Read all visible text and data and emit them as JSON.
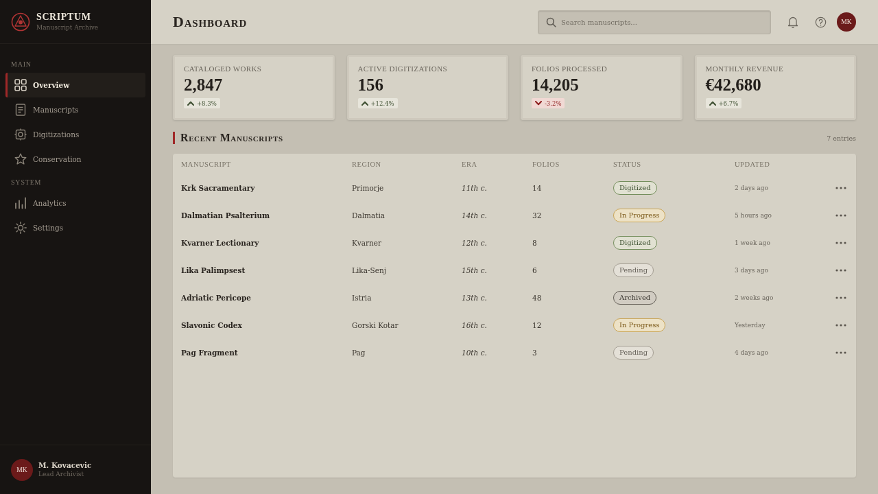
{
  "brand": {
    "name": "SCRIPTUM",
    "tagline": "Manuscript Archive"
  },
  "nav": [
    {
      "section": "MAIN",
      "items": [
        {
          "label": "Overview",
          "selected": true
        },
        {
          "label": "Manuscripts",
          "selected": false
        },
        {
          "label": "Digitizations",
          "selected": false
        },
        {
          "label": "Conservation",
          "selected": false
        }
      ]
    },
    {
      "section": "SYSTEM",
      "items": [
        {
          "label": "Analytics",
          "selected": false
        },
        {
          "label": "Settings",
          "selected": false
        }
      ]
    }
  ],
  "user": {
    "initials": "MK",
    "name": "M. Kovacevic",
    "role": "Lead Archivist"
  },
  "header": {
    "title": "Dashboard",
    "search": {
      "placeholder": "Search manuscripts..."
    },
    "avatar_initials": "MK"
  },
  "stats": [
    {
      "label": "CATALOGED WORKS",
      "value": "2,847",
      "change": {
        "kind": "up",
        "text": "+8.3%"
      }
    },
    {
      "label": "ACTIVE DIGITIZATIONS",
      "value": "156",
      "change": {
        "kind": "up",
        "text": "+12.4%"
      }
    },
    {
      "label": "FOLIOS PROCESSED",
      "value": "14,205",
      "change": {
        "kind": "down",
        "text": "-3.2%"
      }
    },
    {
      "label": "MONTHLY REVENUE",
      "value": "€42,680",
      "change": {
        "kind": "up",
        "text": "+6.7%"
      }
    }
  ],
  "recent": {
    "title": "Recent Manuscripts",
    "count": "7 entries",
    "columns": [
      "MANUSCRIPT",
      "REGION",
      "ERA",
      "FOLIOS",
      "STATUS",
      "UPDATED"
    ],
    "rows": [
      {
        "manuscript": "Krk Sacramentary",
        "region": "Primorje",
        "era": "11th c.",
        "folios": "14",
        "status": {
          "label": "Digitized",
          "kind": "digitized"
        },
        "updated": "2 days ago"
      },
      {
        "manuscript": "Dalmatian Psalterium",
        "region": "Dalmatia",
        "era": "14th c.",
        "folios": "32",
        "status": {
          "label": "In Progress",
          "kind": "progress"
        },
        "updated": "5 hours ago"
      },
      {
        "manuscript": "Kvarner Lectionary",
        "region": "Kvarner",
        "era": "12th c.",
        "folios": "8",
        "status": {
          "label": "Digitized",
          "kind": "digitized"
        },
        "updated": "1 week ago"
      },
      {
        "manuscript": "Lika Palimpsest",
        "region": "Lika-Senj",
        "era": "15th c.",
        "folios": "6",
        "status": {
          "label": "Pending",
          "kind": "pending"
        },
        "updated": "3 days ago"
      },
      {
        "manuscript": "Adriatic Pericope",
        "region": "Istria",
        "era": "13th c.",
        "folios": "48",
        "status": {
          "label": "Archived",
          "kind": "archived"
        },
        "updated": "2 weeks ago"
      },
      {
        "manuscript": "Slavonic Codex",
        "region": "Gorski Kotar",
        "era": "16th c.",
        "folios": "12",
        "status": {
          "label": "In Progress",
          "kind": "progress"
        },
        "updated": "Yesterday"
      },
      {
        "manuscript": "Pag Fragment",
        "region": "Pag",
        "era": "10th c.",
        "folios": "3",
        "status": {
          "label": "Pending",
          "kind": "pending"
        },
        "updated": "4 days ago"
      }
    ]
  }
}
